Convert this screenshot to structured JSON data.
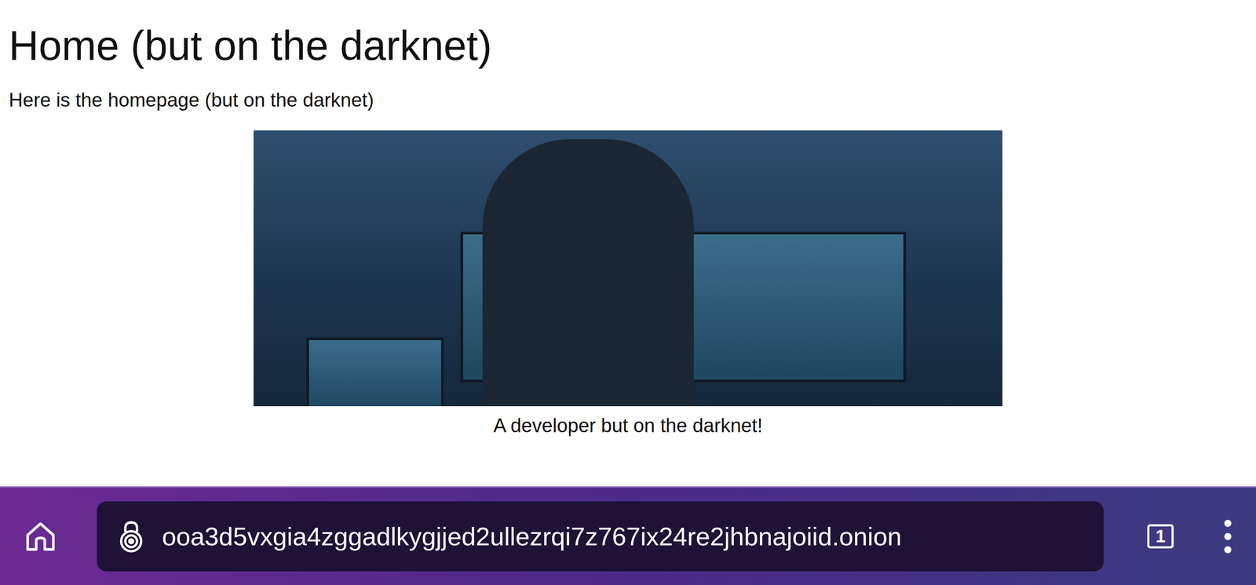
{
  "page": {
    "heading": "Home (but on the darknet)",
    "paragraph": "Here is the homepage (but on the darknet)",
    "figure": {
      "caption": "A developer but on the darknet!"
    }
  },
  "toolbar": {
    "url": "ooa3d5vxgia4zggadlkygjjed2ullezrqi7z767ix24re2jhbnajoiid.onion",
    "tab_count": "1"
  }
}
